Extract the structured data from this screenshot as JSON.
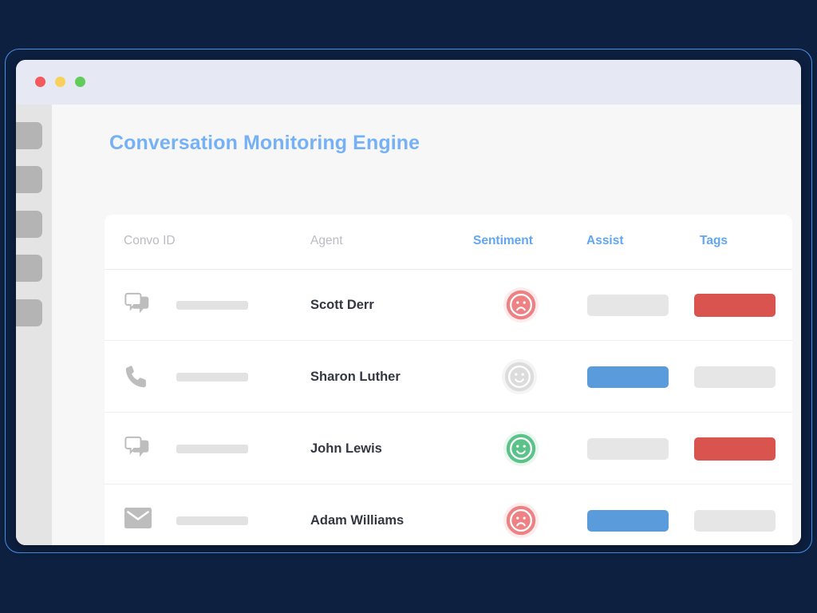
{
  "window": {
    "frame_border_color": "#4a90e2",
    "desktop_bg": "#0d2040",
    "chrome_bg": "#e6e9f4",
    "traffic_lights": [
      {
        "name": "close",
        "color": "#f4595b"
      },
      {
        "name": "minimize",
        "color": "#f8d15c"
      },
      {
        "name": "maximize",
        "color": "#62cc5a"
      }
    ],
    "address_bar_value": "",
    "address_bar_placeholder": "",
    "icons": [
      "reload-icon",
      "plus-icon",
      "tabs-icon"
    ]
  },
  "sidebar": {
    "bg": "#e4e4e4",
    "items": [
      {
        "label": "",
        "name": "sidebar-item-1"
      },
      {
        "label": "",
        "name": "sidebar-item-2"
      },
      {
        "label": "",
        "name": "sidebar-item-3"
      },
      {
        "label": "",
        "name": "sidebar-item-4"
      },
      {
        "label": "",
        "name": "sidebar-item-5"
      }
    ]
  },
  "page": {
    "title": "Conversation Monitoring Engine",
    "title_color": "#75b1f4",
    "bg": "#f7f7f8"
  },
  "table": {
    "columns": [
      {
        "label": "Convo ID",
        "style": "muted"
      },
      {
        "label": "Agent",
        "style": "muted"
      },
      {
        "label": "Sentiment",
        "style": "accent"
      },
      {
        "label": "Assist",
        "style": "accent"
      },
      {
        "label": "Tags",
        "style": "accent"
      }
    ],
    "rows": [
      {
        "channel_icon": "chat-icon",
        "convo_id": "",
        "agent": "Scott Derr",
        "sentiment": "negative",
        "sentiment_color": "#ed8183",
        "assist": "off",
        "assist_color": "#e6e6e6",
        "tag": "on",
        "tag_color": "#d9534f"
      },
      {
        "channel_icon": "phone-icon",
        "convo_id": "",
        "agent": "Sharon Luther",
        "sentiment": "neutral",
        "sentiment_color": "#dcdcdc",
        "assist": "on",
        "assist_color": "#5a9bdc",
        "tag": "off",
        "tag_color": "#e6e6e6"
      },
      {
        "channel_icon": "chat-icon",
        "convo_id": "",
        "agent": "John Lewis",
        "sentiment": "positive",
        "sentiment_color": "#5bc38a",
        "assist": "off",
        "assist_color": "#e6e6e6",
        "tag": "on",
        "tag_color": "#d9534f"
      },
      {
        "channel_icon": "email-icon",
        "convo_id": "",
        "agent": "Adam Williams",
        "sentiment": "negative",
        "sentiment_color": "#ed8183",
        "assist": "on",
        "assist_color": "#5a9bdc",
        "tag": "off",
        "tag_color": "#e6e6e6"
      }
    ]
  }
}
